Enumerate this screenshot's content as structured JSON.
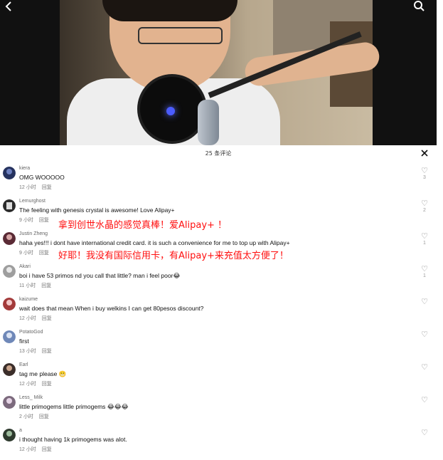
{
  "header": {
    "back_icon": "chevron-left-icon",
    "search_icon": "search-icon"
  },
  "sheet": {
    "title": "25 条评论",
    "close_icon": "close-icon"
  },
  "comments": [
    {
      "user": "kiera",
      "text": "OMG WOOOOO",
      "time": "12 小时",
      "reply": "回复",
      "likes": "3",
      "avatar_color": "#25325e"
    },
    {
      "user": "Lemurghost",
      "text": "The feeling with genesis crystal is awesome! Love Alipay+",
      "time": "9 小时",
      "reply": "回复",
      "likes": "2",
      "avatar_color": "#2b2b2b"
    },
    {
      "user": "Justin  Zheng",
      "text": "haha yes!!! i dont have international credit card. it is such a convenience for me to top up with Alipay+",
      "time": "9 小时",
      "reply": "回复",
      "likes": "1",
      "avatar_color": "#5a2a35"
    },
    {
      "user": "Akari",
      "text": "boi i have 53 primos nd you call that little? man i feel poor😂",
      "time": "11 小时",
      "reply": "回复",
      "likes": "1",
      "avatar_color": "#9e9e9e"
    },
    {
      "user": "kaizume",
      "text": "wait does that mean When i buy welkins I can get 80pesos discount?",
      "time": "12 小时",
      "reply": "回复",
      "likes": "",
      "avatar_color": "#a33a3a"
    },
    {
      "user": "PotatoGod",
      "text": "first",
      "time": "13 小时",
      "reply": "回复",
      "likes": "",
      "avatar_color": "#6f88b8"
    },
    {
      "user": "Earl",
      "text": "tag me please 😬",
      "time": "12 小时",
      "reply": "回复",
      "likes": "",
      "avatar_color": "#3b2e2a"
    },
    {
      "user": "Less_ Milk",
      "text": "little primogems little primogems 😂😂😂",
      "time": "2 小时",
      "reply": "回复",
      "likes": "",
      "avatar_color": "#7c6a7d"
    },
    {
      "user": "a",
      "text": "i thought having 1k primogems was alot.",
      "time": "12 小时",
      "reply": "回复",
      "likes": "",
      "avatar_color": "#2e3a2e"
    }
  ],
  "overlays": [
    {
      "text": "拿到创世水晶的感觉真棒！爱Alipay+ ！"
    },
    {
      "text": "好耶！我没有国际信用卡，有Alipay+来充值太方便了！"
    }
  ]
}
